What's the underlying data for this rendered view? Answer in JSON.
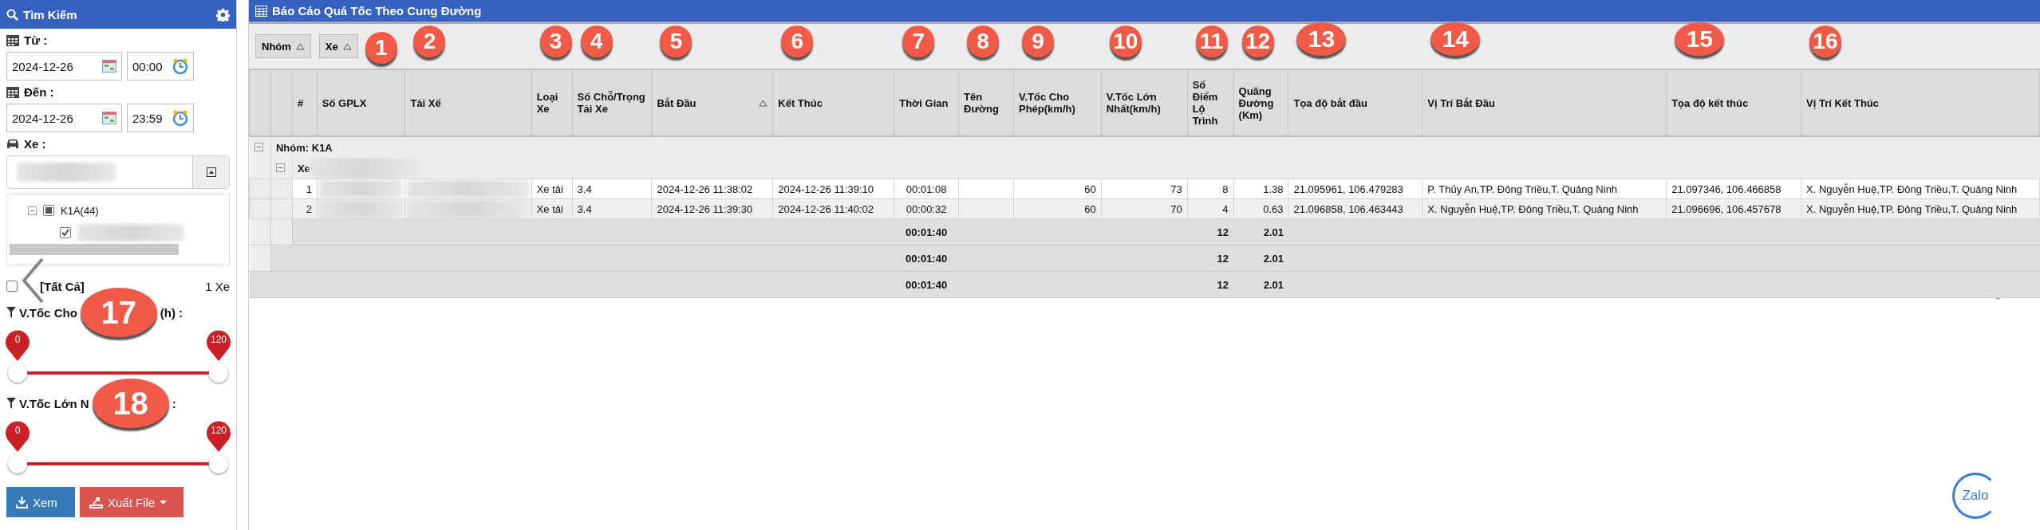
{
  "search_panel": {
    "title": "Tìm Kiếm",
    "from": {
      "label": "Từ :",
      "date": "2024-12-26",
      "time": "00:00"
    },
    "to": {
      "label": "Đến :",
      "date": "2024-12-26",
      "time": "23:59"
    },
    "vehicle": {
      "label": "Xe :",
      "tree": [
        {
          "label": "K1A(44)",
          "checked": false,
          "indeterminate": true,
          "expanded": true,
          "children": [
            {
              "checked": true
            }
          ]
        }
      ]
    },
    "select_all": {
      "label": "[Tất Cả]",
      "checked": false,
      "count": "1 Xe"
    },
    "sliders": [
      {
        "label_start": "V.Tốc Cho",
        "label_end": "(h) :",
        "marker": "17",
        "thumbs": [
          {
            "label": "0",
            "level": 0
          },
          {
            "label": "120",
            "level": 1
          }
        ]
      },
      {
        "label_start": "V.Tốc Lớn N",
        "label_end": ":",
        "marker": "18",
        "thumbs": [
          {
            "label": "0",
            "level": 0
          },
          {
            "label": "120",
            "level": 1
          }
        ]
      }
    ],
    "buttons": [
      {
        "kind": "view",
        "label": "Xem"
      },
      {
        "kind": "export",
        "label": "Xuất File"
      }
    ]
  },
  "report": {
    "title": "Báo Cáo Quá Tốc Theo Cung Đường",
    "group_chips": [
      {
        "label": "Nhóm"
      },
      {
        "label": "Xe"
      }
    ],
    "columns": [
      {
        "label": "#"
      },
      {
        "label": "Số GPLX",
        "marker": "1"
      },
      {
        "label": "Tài Xế",
        "marker": "2"
      },
      {
        "label": "Loại Xe",
        "marker": "3"
      },
      {
        "label": "Số Chỗ/Trọng Tải Xe",
        "marker": "4"
      },
      {
        "label": "Bắt Đầu",
        "marker": "5",
        "sorted": true
      },
      {
        "label": "Kết Thúc",
        "marker": "6"
      },
      {
        "label": "Thời Gian",
        "marker": "7"
      },
      {
        "label": "Tên Đường",
        "marker": "8"
      },
      {
        "label": "V.Tốc Cho Phép(km/h)",
        "marker": "9"
      },
      {
        "label": "V.Tốc Lớn Nhất(km/h)",
        "marker": "10"
      },
      {
        "label": "Số Điểm Lộ Trình",
        "marker": "11"
      },
      {
        "label": "Quãng Đường (Km)",
        "marker": "12"
      },
      {
        "label": "Tọa độ bắt đầu",
        "marker": "13"
      },
      {
        "label": "Vị Trí Bắt Đầu",
        "marker": "14"
      },
      {
        "label": "Tọa độ kết thúc",
        "marker": "15"
      },
      {
        "label": "Vị Trí Kết Thúc",
        "marker": "16"
      }
    ],
    "group": {
      "label": "Nhóm: K1A",
      "expanded": true,
      "subgroup": {
        "label": "Xe",
        "expanded": true
      }
    },
    "rows": [
      {
        "cells": [
          "1",
          {
            "kind": "blurred"
          },
          {
            "kind": "blurred"
          },
          "Xe tải",
          "3.4",
          "2024-12-26 11:38:02",
          "2024-12-26 11:39:10",
          "00:01:08",
          {
            "kind": "empty"
          },
          "60",
          "73",
          "8",
          "1.38",
          "21.095961, 106.479283",
          "P. Thủy An,TP. Đông Triều,T. Quảng Ninh",
          "21.097346, 106.466858",
          "X. Nguyễn Huệ,TP. Đông Triều,T. Quảng Ninh"
        ]
      },
      {
        "cells": [
          "2",
          {
            "kind": "blurred"
          },
          {
            "kind": "blurred"
          },
          "Xe tải",
          "3.4",
          "2024-12-26 11:39:30",
          "2024-12-26 11:40:02",
          "00:00:32",
          {
            "kind": "empty"
          },
          "60",
          "70",
          "4",
          "0.63",
          "21.096858, 106.463443",
          "X. Nguyễn Huệ,TP. Đông Triều,T. Quảng Ninh",
          "21.096696, 106.457678",
          "X. Nguyễn Huệ,TP. Đông Triều,T. Quảng Ninh"
        ]
      }
    ],
    "summaries": [
      {
        "kind": "subgroup",
        "time": "00:01:40",
        "points": "12",
        "distance": "2.01"
      },
      {
        "kind": "group",
        "time": "00:01:40",
        "points": "12",
        "distance": "2.01"
      },
      {
        "kind": "total",
        "time": "00:01:40",
        "points": "12",
        "distance": "2.01"
      }
    ]
  },
  "zalo_badge": "Zalo"
}
